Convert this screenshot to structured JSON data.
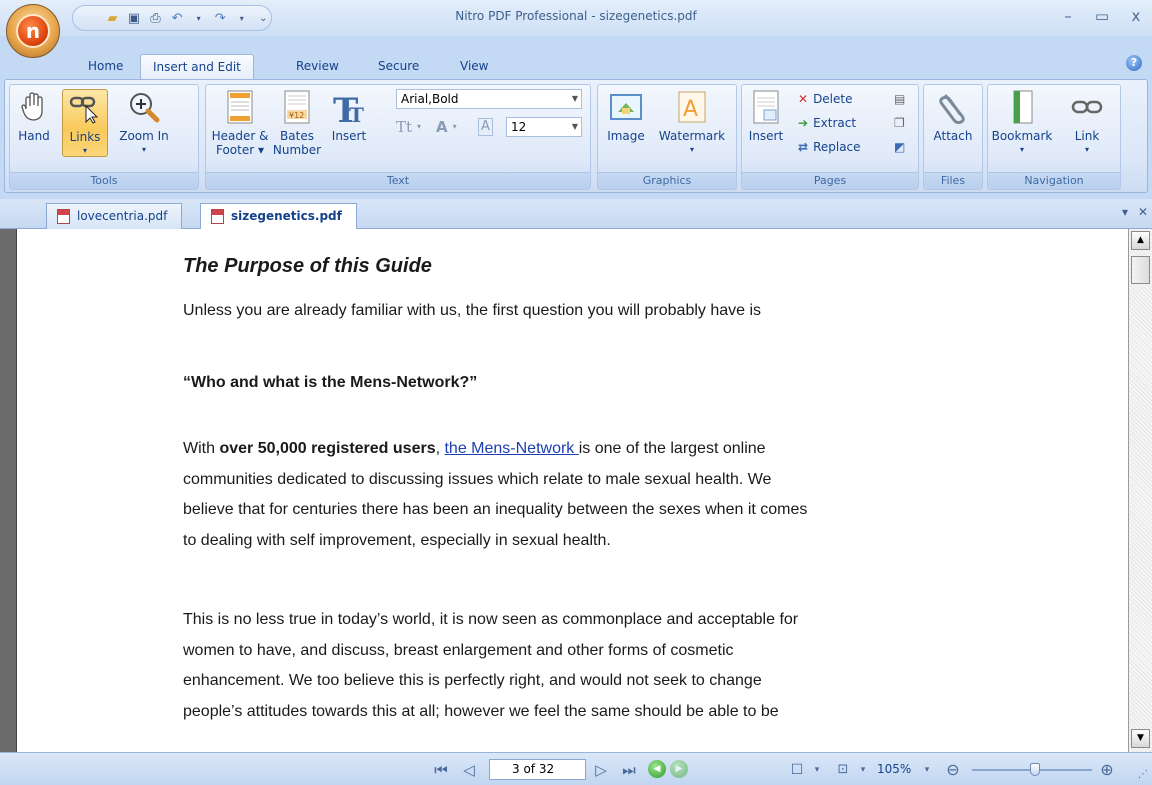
{
  "window": {
    "title": "Nitro PDF Professional - sizegenetics.pdf",
    "min": "–",
    "max": "▭",
    "close": "x"
  },
  "ribbon_tabs": [
    "Home",
    "Insert and Edit",
    "Review",
    "Secure",
    "View"
  ],
  "ribbon": {
    "tools": {
      "label": "Tools",
      "hand": "Hand",
      "links": "Links",
      "zoom_in": "Zoom In"
    },
    "text": {
      "label": "Text",
      "header_footer_1": "Header &",
      "header_footer_2": "Footer ▾",
      "bates_1": "Bates",
      "bates_2": "Number",
      "insert": "Insert",
      "font": "Arial,Bold",
      "size": "12",
      "bates_icon": "¥12"
    },
    "graphics": {
      "label": "Graphics",
      "image": "Image",
      "watermark": "Watermark"
    },
    "pages": {
      "label": "Pages",
      "insert": "Insert",
      "delete": "Delete",
      "extract": "Extract",
      "replace": "Replace"
    },
    "files": {
      "label": "Files",
      "attach": "Attach"
    },
    "navigation": {
      "label": "Navigation",
      "bookmark": "Bookmark",
      "link": "Link"
    }
  },
  "doc_tabs": [
    "lovecentria.pdf",
    "sizegenetics.pdf"
  ],
  "document": {
    "title": "The Purpose of this Guide",
    "p1": "Unless you are already familiar with us, the first question you will probably have is",
    "p2": "“Who and what is the Mens-Network?”",
    "p3_a": "With ",
    "p3_bold": "over 50,000 registered users",
    "p3_b": ", ",
    "p3_link": "the Mens-Network ",
    "p3_c": "is one of the largest online",
    "p3_l2": "communities dedicated to discussing issues which relate to male sexual health. We",
    "p3_l3": "believe that for centuries there has been an inequality between the sexes when it comes",
    "p3_l4": "to dealing with self improvement, especially in sexual health.",
    "p4_l1": "This is no less true in today’s world, it is now seen as commonplace and acceptable for",
    "p4_l2": "women to have, and discuss, breast enlargement and other forms of cosmetic",
    "p4_l3": "enhancement. We too believe this is perfectly right, and would not seek to change",
    "p4_l4": "people’s attitudes towards this at all; however we feel the same should be able to be"
  },
  "statusbar": {
    "page": "3 of 32",
    "zoom": "105%"
  },
  "colors": {
    "accent": "#15428b",
    "pressed": "#f9c95b",
    "link": "#1a3fb0"
  }
}
